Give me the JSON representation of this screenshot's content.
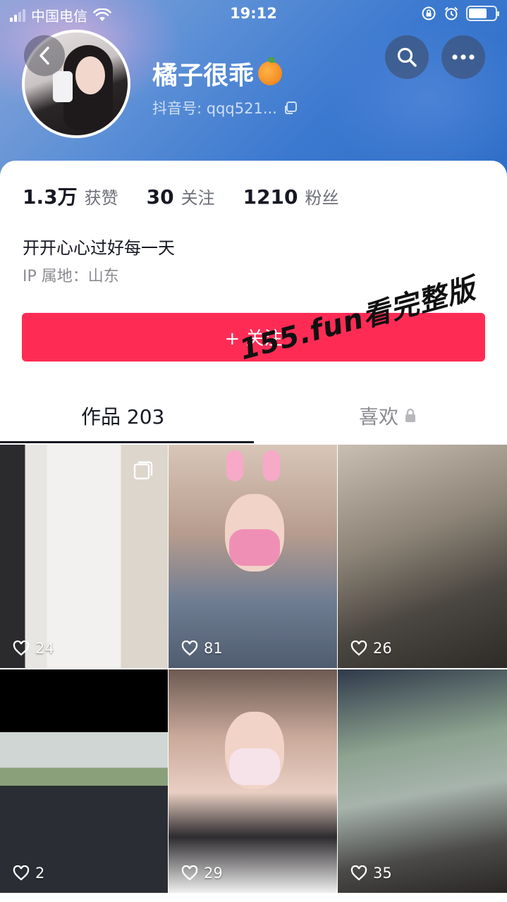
{
  "status_bar": {
    "carrier": "中国电信",
    "time": "19:12"
  },
  "profile": {
    "nickname": "橘子很乖",
    "douyin_id": "抖音号: qqq521...",
    "stats": [
      {
        "value": "1.3万",
        "label": "获赞"
      },
      {
        "value": "30",
        "label": "关注"
      },
      {
        "value": "1210",
        "label": "粉丝"
      }
    ],
    "bio": "开开心心过好每一天",
    "ip_location": "IP 属地：山东"
  },
  "follow_button": {
    "label": "+ 关注"
  },
  "tabs": {
    "works": "作品 203",
    "likes": "喜欢"
  },
  "watermark": "155.fun看完整版",
  "videos": [
    {
      "likes": "24"
    },
    {
      "likes": "81"
    },
    {
      "likes": "26"
    },
    {
      "likes": "2"
    },
    {
      "likes": "29"
    },
    {
      "likes": "35"
    }
  ],
  "colors": {
    "accent": "#fe2c55",
    "banner": "#3b78cf",
    "text_primary": "#161823",
    "text_secondary": "#8a8b91"
  }
}
